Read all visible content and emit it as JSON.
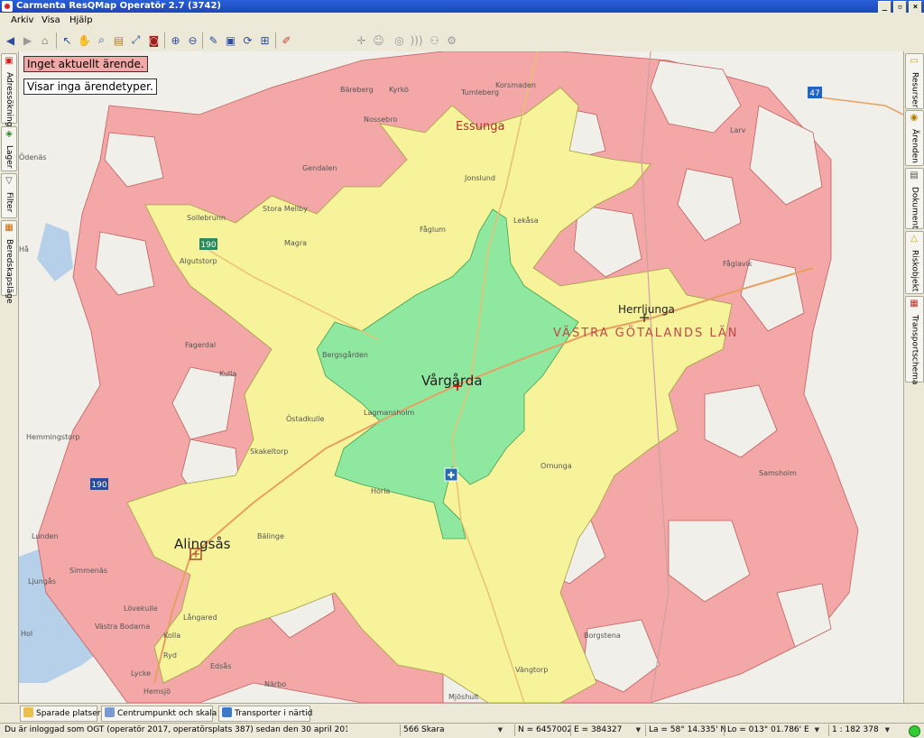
{
  "window": {
    "title": "Carmenta ResQMap Operatör 2.7 (3742)",
    "minimize_label": "_",
    "restore_label": "▫",
    "close_label": "×"
  },
  "menu": [
    "Arkiv",
    "Visa",
    "Hjälp"
  ],
  "toolbar_icons": [
    "back-icon",
    "forward-icon",
    "home-icon",
    "pointer-icon",
    "pan-hand-icon",
    "zoom-rect-icon",
    "measure-icon",
    "locate-icon",
    "goto-icon",
    "zoom-in-icon",
    "zoom-out-icon",
    "draw-icon",
    "layer-icon",
    "refresh-icon",
    "extent-icon",
    "eraser-icon"
  ],
  "banners": {
    "no_case": "Inget aktuellt ärende.",
    "no_types": "Visar inga ärendetyper."
  },
  "left_tabs": [
    "Adressökning",
    "Lager",
    "Filter",
    "Beredskapsläge"
  ],
  "right_tabs": [
    "Resurser",
    "Ärenden",
    "Dokument",
    "Riskobjekt",
    "Transportschema"
  ],
  "map": {
    "region_label": "VÄSTRA GÖTALANDS LÄN",
    "road_shields": [
      "190",
      "190",
      "47"
    ],
    "places_major": [
      "Vårgårda",
      "Alingsås",
      "Herrljunga",
      "Essunga"
    ],
    "places_minor": [
      "Bäreberg",
      "Kyrkö",
      "Tumleberg",
      "Korsmaden",
      "Nossebro",
      "Gendalen",
      "Jonslund",
      "Stora Mellby",
      "Sollebrunn",
      "Magra",
      "Fåglum",
      "Lekåsa",
      "Fåglavik",
      "Larv",
      "Algutstorp",
      "Fagerdal",
      "Kulla",
      "Bergsgården",
      "Östadkulle",
      "Lagmansholm",
      "Skakeltorp",
      "Horla",
      "Ornunga",
      "Bälinge",
      "Lunden",
      "Simmenäs",
      "Västra Bodarna",
      "Ryd",
      "Hemmingstorp",
      "Borgstena",
      "Långared",
      "Hemsjö",
      "Mjöshult",
      "Hol",
      "Ljungås",
      "Samsholm",
      "Vängtorp",
      "Edsås",
      "Lövekulle",
      "Lycke",
      "Kolla",
      "Ödenäs",
      "Närbo",
      "Hå"
    ]
  },
  "bottom_tabs": [
    "Sparade platser",
    "Centrumpunkt och skala",
    "Transporter i närtid"
  ],
  "status": {
    "login": "Du är inloggad som OGT (operatör 2017, operatörsplats 387) sedan den 30 april 2010 07:54. Norm",
    "municipality": "566 Skara",
    "northing": "N = 6457002",
    "easting": "E = 384327",
    "lat": "La = 58° 14.335' N",
    "lon": "Lo = 013° 01.786' E",
    "scale": "1 : 182 378"
  },
  "colors": {
    "zone_red": "#f4a7a7",
    "zone_yellow": "#f7f39a",
    "zone_green": "#8fe8a0",
    "water": "#b5d0e8",
    "titlebar": "#1f4fc5"
  }
}
